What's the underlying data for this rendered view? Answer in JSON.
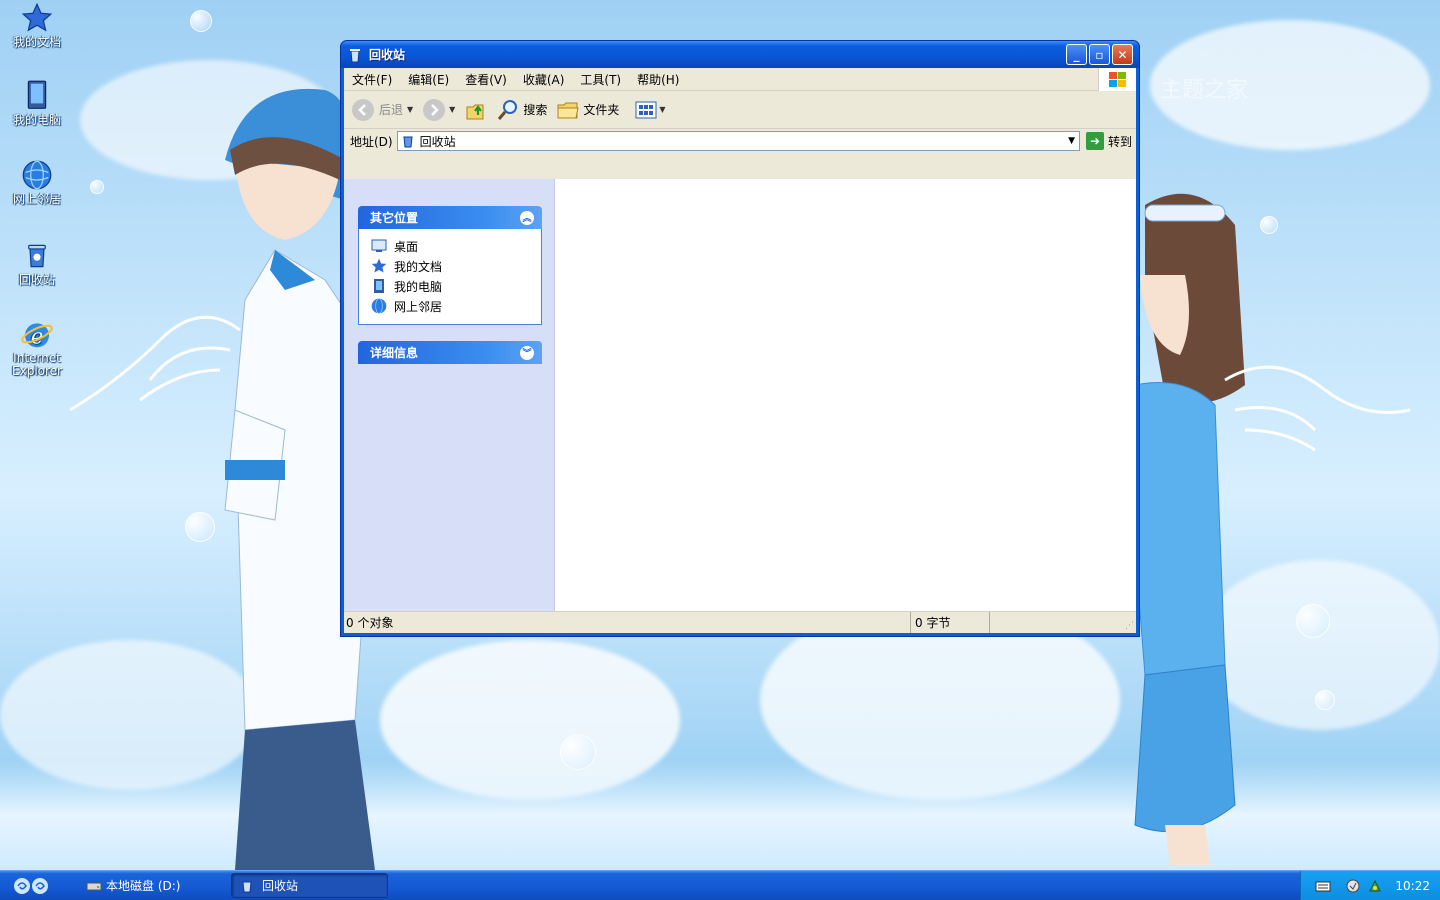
{
  "desktop": {
    "icons": [
      {
        "label": "我的文档",
        "icon": "star-icon"
      },
      {
        "label": "我的电脑",
        "icon": "computer-icon"
      },
      {
        "label": "网上邻居",
        "icon": "network-globe-icon"
      },
      {
        "label": "回收站",
        "icon": "recycle-bin-icon"
      },
      {
        "label": "Internet\nExplorer",
        "icon": "ie-icon"
      }
    ],
    "watermark": "主题之家"
  },
  "window": {
    "title": "回收站",
    "menu": [
      "文件(F)",
      "编辑(E)",
      "查看(V)",
      "收藏(A)",
      "工具(T)",
      "帮助(H)"
    ],
    "toolbar": {
      "back": "后退",
      "search": "搜索",
      "folders": "文件夹"
    },
    "address": {
      "label": "地址(D)",
      "value": "回收站",
      "go": "转到"
    },
    "taskpane": {
      "other_places": {
        "title": "其它位置",
        "items": [
          {
            "label": "桌面",
            "icon": "desktop-icon"
          },
          {
            "label": "我的文档",
            "icon": "star-icon"
          },
          {
            "label": "我的电脑",
            "icon": "computer-icon"
          },
          {
            "label": "网上邻居",
            "icon": "network-globe-icon"
          }
        ]
      },
      "details": {
        "title": "详细信息"
      }
    },
    "status": {
      "objects": "0 个对象",
      "size": "0 字节"
    }
  },
  "taskbar": {
    "items": [
      {
        "label": "本地磁盘 (D:)",
        "active": false
      },
      {
        "label": "回收站",
        "active": true
      }
    ],
    "clock": "10:22"
  },
  "colors": {
    "title_blue": "#0a55d4",
    "taskpane_bg": "#d6dff7",
    "taskbar_blue": "#1459d3",
    "tray_blue": "#0d8de0"
  }
}
